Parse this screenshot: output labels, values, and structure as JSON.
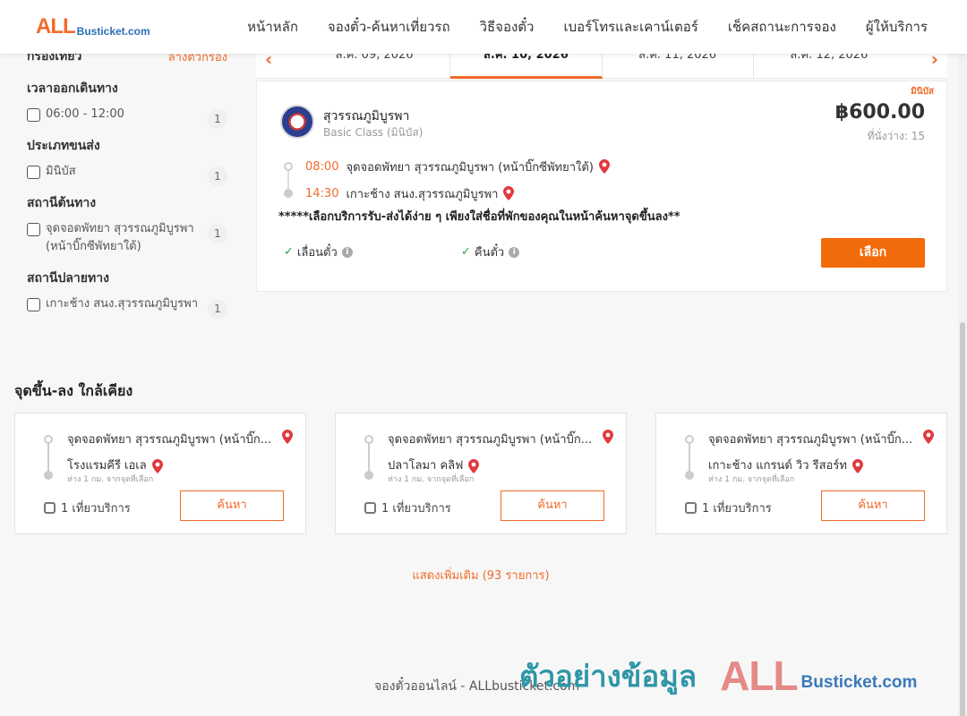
{
  "header": {
    "logo_big": "ALL",
    "logo_small": "Busticket.com",
    "nav": [
      "หน้าหลัก",
      "จองตั๋ว-ค้นหาเที่ยวรถ",
      "วิธีจองตั๋ว",
      "เบอร์โทรและเคาน์เตอร์",
      "เช็คสถานะการจอง",
      "ผู้ให้บริการ"
    ]
  },
  "filter": {
    "title": "กรองเที่ยว",
    "clear": "ล้างตัวกรอง",
    "groups": [
      {
        "title": "เวลาออกเดินทาง",
        "options": [
          {
            "label": "06:00 - 12:00",
            "count": "1"
          }
        ]
      },
      {
        "title": "ประเภทขนส่ง",
        "options": [
          {
            "label": "มินิบัส",
            "count": "1"
          }
        ]
      },
      {
        "title": "สถานีต้นทาง",
        "options": [
          {
            "label": "จุดจอดพัทยา สุวรรณภูมิบูรพา (หน้าบิ๊กซีพัทยาใต้)",
            "count": "1"
          }
        ]
      },
      {
        "title": "สถานีปลายทาง",
        "options": [
          {
            "label": "เกาะช้าง สนง.สุวรรณภูมิบูรพา",
            "count": "1"
          }
        ]
      }
    ]
  },
  "dates": {
    "prev": "‹",
    "next": "›",
    "items": [
      "ส.ค. 09, 2026",
      "ส.ค. 10, 2026",
      "ส.ค. 11, 2026",
      "ส.ค. 12, 2026"
    ],
    "active_index": 1
  },
  "trip": {
    "badge": "มินิบัส",
    "operator": "สุวรรณภูมิบูรพา",
    "class": "Basic Class (มินิบัส)",
    "price": "฿600.00",
    "seats": "ที่นั่งว่าง: 15",
    "departure_time": "08:00",
    "departure_place": "จุดจอดพัทยา สุวรรณภูมิบูรพา (หน้าบิ๊กซีพัทยาใต้)",
    "arrival_time": "14:30",
    "arrival_place": "เกาะช้าง สนง.สุวรรณภูมิบูรพา",
    "note": "*****เลือกบริการรับ-ส่งได้ง่าย ๆ เพียงใส่ชื่อที่พักของคุณในหน้าค้นหาจุดขึ้นลง**",
    "feature1": "เลื่อนตั๋ว",
    "feature2": "คืนตั๋ว",
    "select_label": "เลือก"
  },
  "nearby": {
    "title": "จุดขึ้น-ลง ใกล้เคียง",
    "cards": [
      {
        "from": "จุดจอดพัทยา สุวรรณภูมิบูรพา (หน้าบิ๊ก...",
        "to": "โรงแรมคีรี เอเล",
        "distance": "ห่าง 1 กม. จากจุดที่เลือก",
        "trips": "1 เที่ยวบริการ",
        "button": "ค้นหา"
      },
      {
        "from": "จุดจอดพัทยา สุวรรณภูมิบูรพา (หน้าบิ๊ก...",
        "to": "ปลาโลมา คลิฟ",
        "distance": "ห่าง 1 กม. จากจุดที่เลือก",
        "trips": "1 เที่ยวบริการ",
        "button": "ค้นหา"
      },
      {
        "from": "จุดจอดพัทยา สุวรรณภูมิบูรพา (หน้าบิ๊ก...",
        "to": "เกาะช้าง แกรนด์ วิว รีสอร์ท",
        "distance": "ห่าง 1 กม. จากจุดที่เลือก",
        "trips": "1 เที่ยวบริการ",
        "button": "ค้นหา"
      }
    ],
    "more": "แสดงเพิ่มเติม (93 รายการ)"
  },
  "footer": {
    "text": "จองตั๋วออนไลน์ - ALLbusticket.com"
  },
  "watermark": {
    "text": "ตัวอย่างข้อมูล",
    "big": "ALL",
    "small": "Busticket.com"
  },
  "colors": {
    "accent": "#f26b2a",
    "button": "#f26b0a",
    "check": "#2c9f45",
    "pin": "#e0393e"
  }
}
